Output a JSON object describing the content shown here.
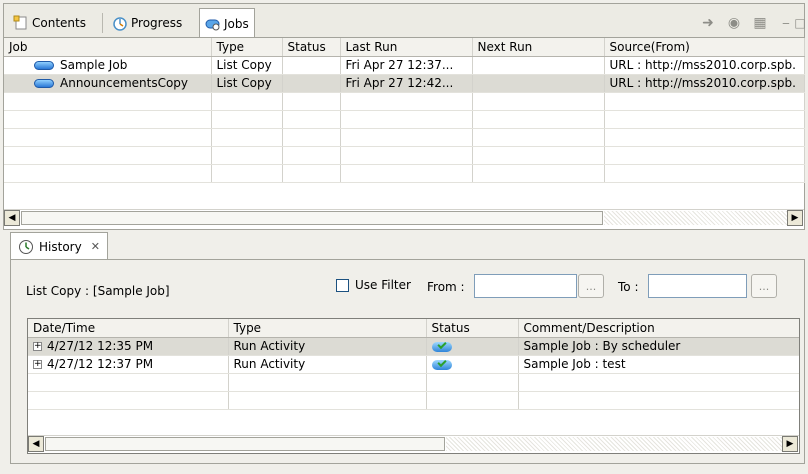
{
  "tabs": [
    {
      "label": "Contents",
      "icon": "contents-icon"
    },
    {
      "label": "Progress",
      "icon": "progress-icon"
    },
    {
      "label": "Jobs",
      "icon": "jobs-icon",
      "active": true
    }
  ],
  "toolbar": {
    "buttons": [
      "run-job-icon",
      "stop-job-icon",
      "job-properties-icon"
    ],
    "minimize": "‒",
    "maximize": "□"
  },
  "jobs": {
    "columns": [
      "Job",
      "Type",
      "Status",
      "Last Run",
      "Next Run",
      "Source(From)"
    ],
    "rows": [
      {
        "job": "Sample Job",
        "type": "List Copy",
        "status": "",
        "last_run": "Fri Apr 27 12:37...",
        "next_run": "",
        "source": "URL : http://mss2010.corp.spb."
      },
      {
        "job": "AnnouncementsCopy",
        "type": "List Copy",
        "status": "",
        "last_run": "Fri Apr 27 12:42...",
        "next_run": "",
        "source": "URL : http://mss2010.corp.spb."
      }
    ]
  },
  "history": {
    "tab_label": "History",
    "close_glyph": "✕",
    "context_label": "List Copy : [Sample Job]",
    "use_filter_label": "Use Filter",
    "from_label": "From :",
    "to_label": "To :",
    "dots_label": "...",
    "columns": [
      "Date/Time",
      "Type",
      "Status",
      "Comment/Description"
    ],
    "rows": [
      {
        "datetime": "4/27/12 12:35 PM",
        "type": "Run Activity",
        "status": "ok",
        "comment": "Sample Job : By scheduler"
      },
      {
        "datetime": "4/27/12 12:37 PM",
        "type": "Run Activity",
        "status": "ok",
        "comment": "Sample Job : test"
      }
    ]
  },
  "colors": {
    "selection": "#dcdbd4",
    "panel_bg": "#f0efea",
    "border": "#a3a39b"
  }
}
